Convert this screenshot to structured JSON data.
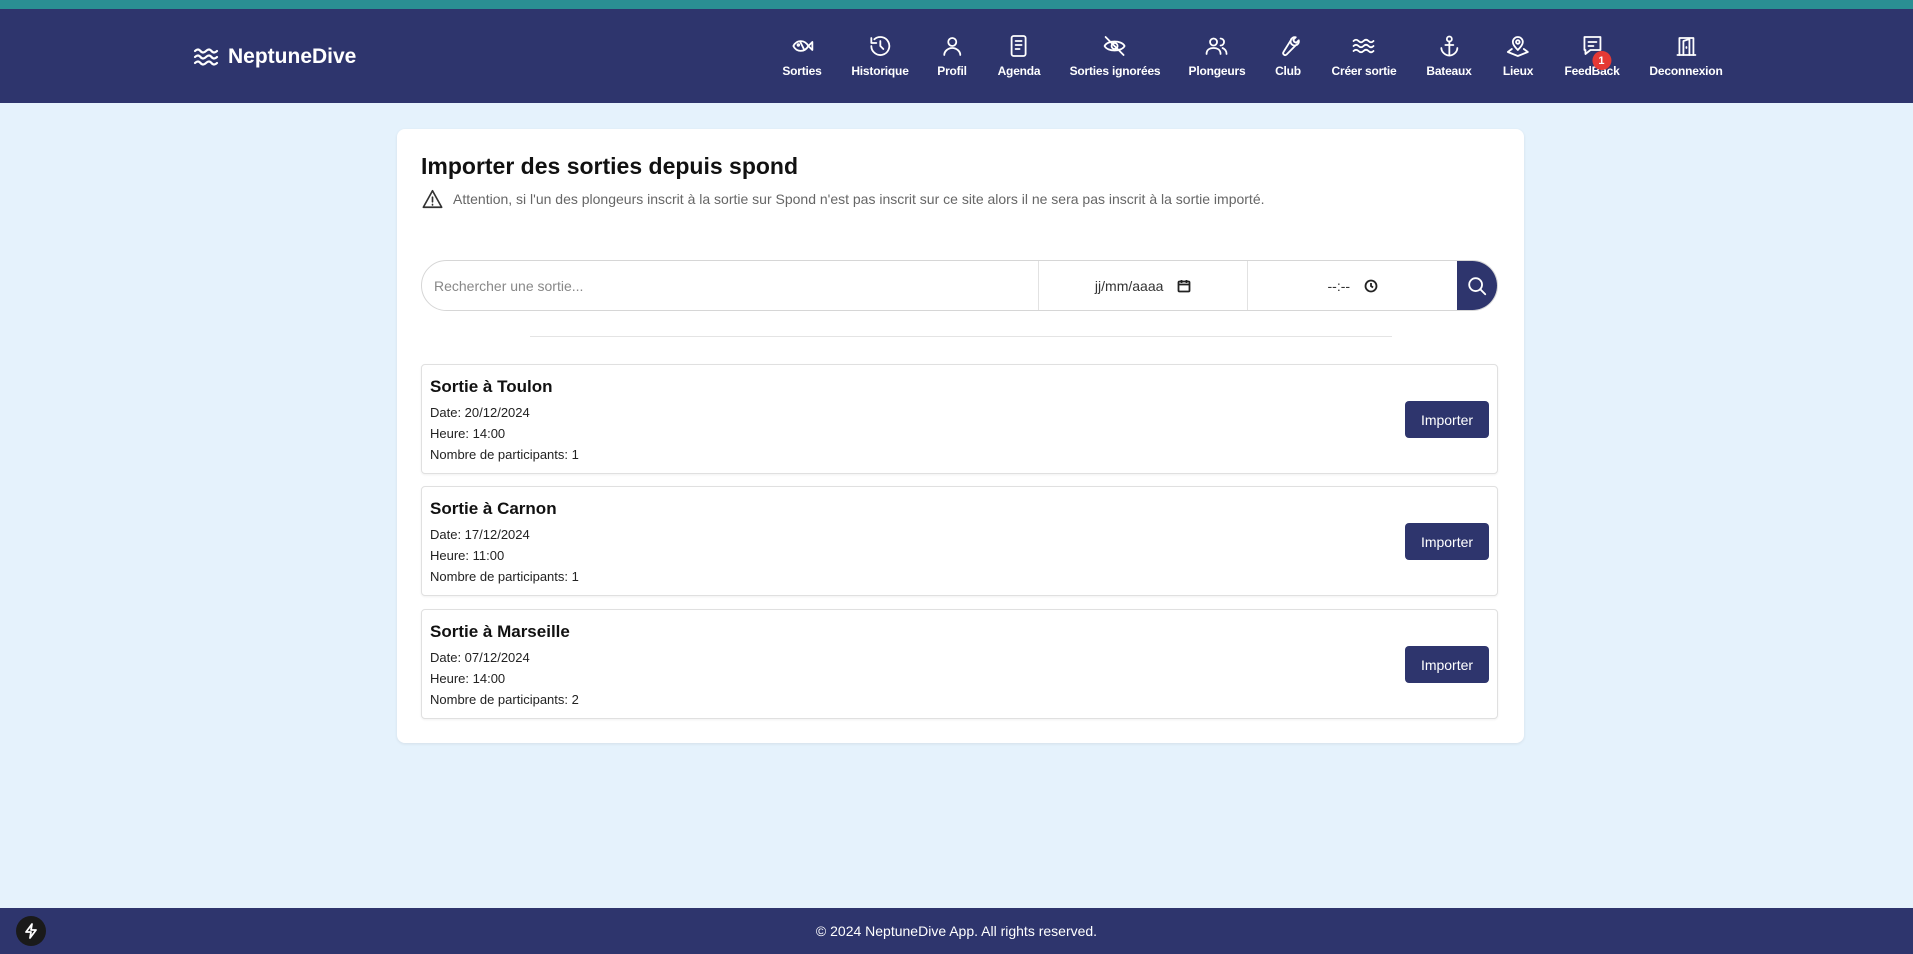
{
  "colors": {
    "navbar": "#2e356d",
    "accent_line": "#2a8f93",
    "page_background": "#e5f2fc",
    "button": "#2e356d",
    "badge": "#e53935"
  },
  "brand": {
    "name": "NeptuneDive",
    "icon": "waves-icon"
  },
  "nav": {
    "items": [
      {
        "label": "Sorties",
        "icon": "fish-icon"
      },
      {
        "label": "Historique",
        "icon": "history-icon"
      },
      {
        "label": "Profil",
        "icon": "user-icon"
      },
      {
        "label": "Agenda",
        "icon": "book-icon"
      },
      {
        "label": "Sorties ignorées",
        "icon": "eye-off-icon"
      },
      {
        "label": "Plongeurs",
        "icon": "users-icon"
      },
      {
        "label": "Club",
        "icon": "wrench-icon"
      },
      {
        "label": "Créer sortie",
        "icon": "waves-icon"
      },
      {
        "label": "Bateaux",
        "icon": "anchor-icon"
      },
      {
        "label": "Lieux",
        "icon": "map-pin-icon"
      },
      {
        "label": "FeedBack",
        "icon": "message-icon",
        "badge": "1"
      },
      {
        "label": "Deconnexion",
        "icon": "door-icon"
      }
    ]
  },
  "page": {
    "title": "Importer des sorties depuis spond",
    "warning": "Attention, si l'un des plongeurs inscrit à la sortie sur Spond n'est pas inscrit sur ce site alors il ne sera pas inscrit à la sortie importé."
  },
  "search": {
    "placeholder": "Rechercher une sortie...",
    "date_placeholder": "jj/mm/aaaa",
    "time_placeholder": "--:--"
  },
  "outings": [
    {
      "title": "Sortie à Toulon",
      "date": "Date: 20/12/2024",
      "time": "Heure: 14:00",
      "participants": "Nombre de participants: 1",
      "button": "Importer"
    },
    {
      "title": "Sortie à Carnon",
      "date": "Date: 17/12/2024",
      "time": "Heure: 11:00",
      "participants": "Nombre de participants: 1",
      "button": "Importer"
    },
    {
      "title": "Sortie à Marseille",
      "date": "Date: 07/12/2024",
      "time": "Heure: 14:00",
      "participants": "Nombre de participants: 2",
      "button": "Importer"
    }
  ],
  "footer": {
    "text": "© 2024 NeptuneDive App. All rights reserved."
  }
}
